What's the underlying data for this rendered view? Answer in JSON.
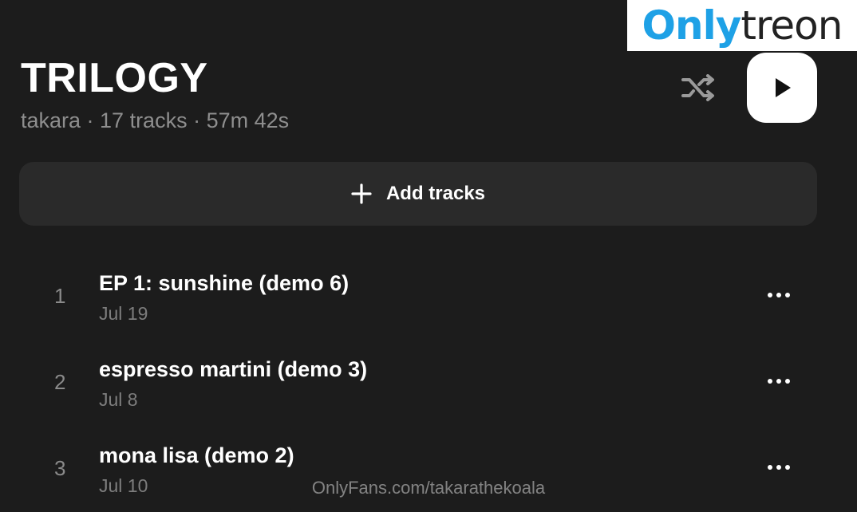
{
  "playlist": {
    "title": "TRILOGY",
    "meta": "takara · 17 tracks · 57m 42s"
  },
  "controls": {
    "shuffle_icon": "shuffle-icon",
    "play_icon": "play-icon"
  },
  "add_tracks": {
    "label": "Add tracks",
    "icon": "plus-icon"
  },
  "tracks": [
    {
      "number": "1",
      "name": "EP 1: sunshine (demo 6)",
      "date": "Jul 19"
    },
    {
      "number": "2",
      "name": "espresso martini (demo 3)",
      "date": "Jul 8"
    },
    {
      "number": "3",
      "name": "mona lisa (demo 2)",
      "date": "Jul 10"
    }
  ],
  "logo": {
    "part1": "Only",
    "part2": "treon",
    "colors": {
      "part1": "#1ea1e6",
      "part2": "#222222"
    }
  },
  "watermark": "OnlyFans.com/takarathekoala",
  "colors": {
    "background": "#1c1c1c",
    "panel": "#2a2a2a",
    "muted_text": "#8e8e8e"
  }
}
